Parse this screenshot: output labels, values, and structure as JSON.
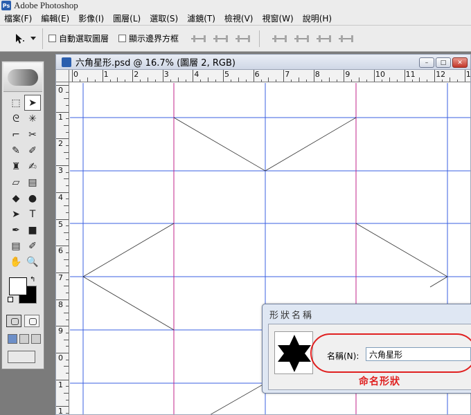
{
  "app": {
    "title": "Adobe Photoshop",
    "logo": "Ps"
  },
  "menubar": {
    "items": [
      {
        "label": "檔案(F)"
      },
      {
        "label": "編輯(E)"
      },
      {
        "label": "影像(I)"
      },
      {
        "label": "圖層(L)"
      },
      {
        "label": "選取(S)"
      },
      {
        "label": "濾鏡(T)"
      },
      {
        "label": "檢視(V)"
      },
      {
        "label": "視窗(W)"
      },
      {
        "label": "說明(H)"
      }
    ]
  },
  "options_bar": {
    "tool_icon": "move-tool-icon",
    "auto_select_label": "自動選取圖層",
    "show_bounds_label": "顯示邊界方框",
    "auto_select_checked": false,
    "show_bounds_checked": false
  },
  "toolbox": {
    "tools": [
      "rect-marquee-icon",
      "move-icon",
      "lasso-icon",
      "magic-wand-icon",
      "crop-icon",
      "slice-icon",
      "healing-brush-icon",
      "brush-icon",
      "clone-stamp-icon",
      "history-brush-icon",
      "eraser-icon",
      "gradient-icon",
      "blur-icon",
      "dodge-icon",
      "path-select-icon",
      "type-icon",
      "pen-icon",
      "rectangle-shape-icon",
      "notes-icon",
      "eyedropper-icon",
      "hand-icon",
      "zoom-icon"
    ],
    "glyphs": [
      "⬚",
      "➤",
      "ᘓ",
      "✳",
      "⌐",
      "✂",
      "✎",
      "✐",
      "♜",
      "✍",
      "▱",
      "▤",
      "◆",
      "●",
      "➤",
      "T",
      "✒",
      "■",
      "▤",
      "✐",
      "✋",
      "🔍"
    ],
    "active_index": 1,
    "foreground_color": "#ffffff",
    "background_color": "#000000"
  },
  "document": {
    "title": "六角星形.psd @ 16.7% (圖層 2, RGB)",
    "ruler_top": [
      "0",
      "1",
      "2",
      "3",
      "4",
      "5",
      "6",
      "7",
      "8",
      "9",
      "10",
      "11",
      "12",
      "13",
      "1"
    ],
    "ruler_left": [
      "0",
      "1",
      "2",
      "3",
      "4",
      "5",
      "6",
      "7",
      "8",
      "9",
      "0",
      "1",
      "1"
    ],
    "guide_color": "#3a5fe0",
    "column_guide_color": "#c0208a"
  },
  "dialog": {
    "title": "形狀名稱",
    "name_label": "名稱(N):",
    "name_value": "六角星形"
  },
  "annotation": {
    "text": "命名形狀",
    "color": "#e02020"
  }
}
